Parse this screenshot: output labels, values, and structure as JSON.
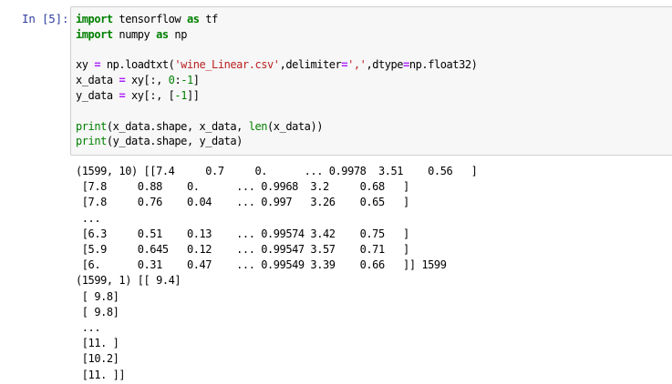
{
  "cell": {
    "prompt": "In [5]:",
    "code_lines": [
      [
        {
          "t": "import",
          "c": "kw"
        },
        {
          "t": " tensorflow "
        },
        {
          "t": "as",
          "c": "kw"
        },
        {
          "t": " tf"
        }
      ],
      [
        {
          "t": "import",
          "c": "kw"
        },
        {
          "t": " numpy "
        },
        {
          "t": "as",
          "c": "kw"
        },
        {
          "t": " np"
        }
      ],
      [],
      [
        {
          "t": "xy "
        },
        {
          "t": "=",
          "c": "op"
        },
        {
          "t": " np.loadtxt("
        },
        {
          "t": "'wine_Linear.csv'",
          "c": "str"
        },
        {
          "t": ",delimiter"
        },
        {
          "t": "=",
          "c": "op"
        },
        {
          "t": "','",
          "c": "str"
        },
        {
          "t": ",dtype"
        },
        {
          "t": "=",
          "c": "op"
        },
        {
          "t": "np.float32)"
        }
      ],
      [
        {
          "t": "x_data "
        },
        {
          "t": "=",
          "c": "op"
        },
        {
          "t": " xy[:, "
        },
        {
          "t": "0",
          "c": "num"
        },
        {
          "t": ":"
        },
        {
          "t": "-1",
          "c": "num"
        },
        {
          "t": "]"
        }
      ],
      [
        {
          "t": "y_data "
        },
        {
          "t": "=",
          "c": "op"
        },
        {
          "t": " xy[:, ["
        },
        {
          "t": "-1",
          "c": "num"
        },
        {
          "t": "]]"
        }
      ],
      [],
      [
        {
          "t": "print",
          "c": "builtin"
        },
        {
          "t": "(x_data.shape, x_data, "
        },
        {
          "t": "len",
          "c": "builtin"
        },
        {
          "t": "(x_data))"
        }
      ],
      [
        {
          "t": "print",
          "c": "builtin"
        },
        {
          "t": "(y_data.shape, y_data)"
        }
      ]
    ],
    "output_lines": [
      "(1599, 10) [[7.4     0.7     0.      ... 0.9978  3.51    0.56   ]",
      " [7.8     0.88    0.      ... 0.9968  3.2     0.68   ]",
      " [7.8     0.76    0.04    ... 0.997   3.26    0.65   ]",
      " ...",
      " [6.3     0.51    0.13    ... 0.99574 3.42    0.75   ]",
      " [5.9     0.645   0.12    ... 0.99547 3.57    0.71   ]",
      " [6.      0.31    0.47    ... 0.99549 3.39    0.66   ]] 1599",
      "(1599, 1) [[ 9.4]",
      " [ 9.8]",
      " [ 9.8]",
      " ...",
      " [11. ]",
      " [10.2]",
      " [11. ]]"
    ]
  },
  "colors": {
    "prompt": "#303f9f",
    "keyword": "#008000",
    "operator": "#aa22ff",
    "string": "#ba2121",
    "number": "#008000",
    "input_background": "#f7f7f7",
    "input_border": "#cfcfcf"
  }
}
